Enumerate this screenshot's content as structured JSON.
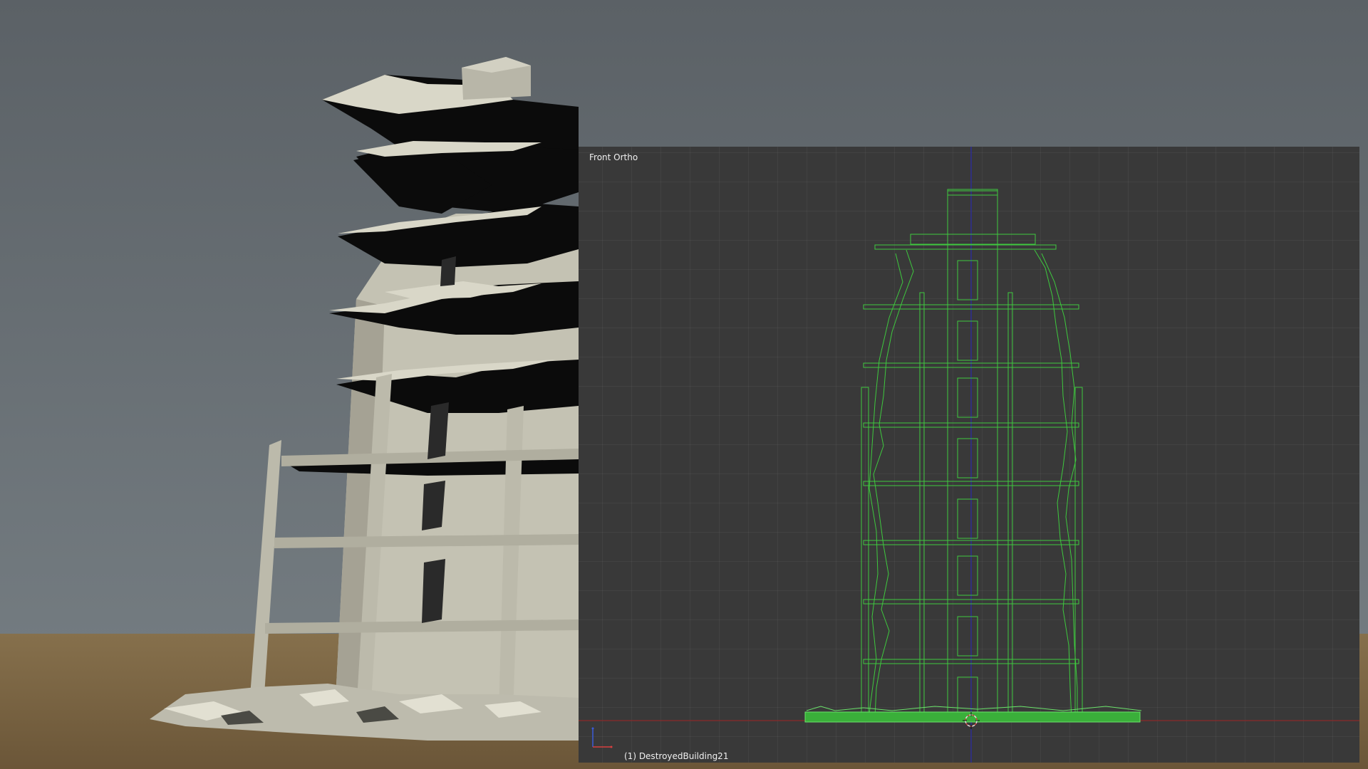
{
  "render_view": {
    "colors": {
      "sky_top": "#5d6368",
      "sky_bottom": "#717a80",
      "ground": "#8a7048",
      "concrete": "#c9c7b8",
      "concrete_shadow": "#9e9b8c",
      "void": "#0a0a0a"
    }
  },
  "wire_view": {
    "view_label": "Front Ortho",
    "object_label": "(1) DestroyedBuilding21",
    "colors": {
      "background": "#393939",
      "wire": "#3ec93e",
      "ground_fill": "#3aaf3a",
      "axis_z": "#2a2aa8",
      "axis_x": "#8a2a2a"
    }
  }
}
